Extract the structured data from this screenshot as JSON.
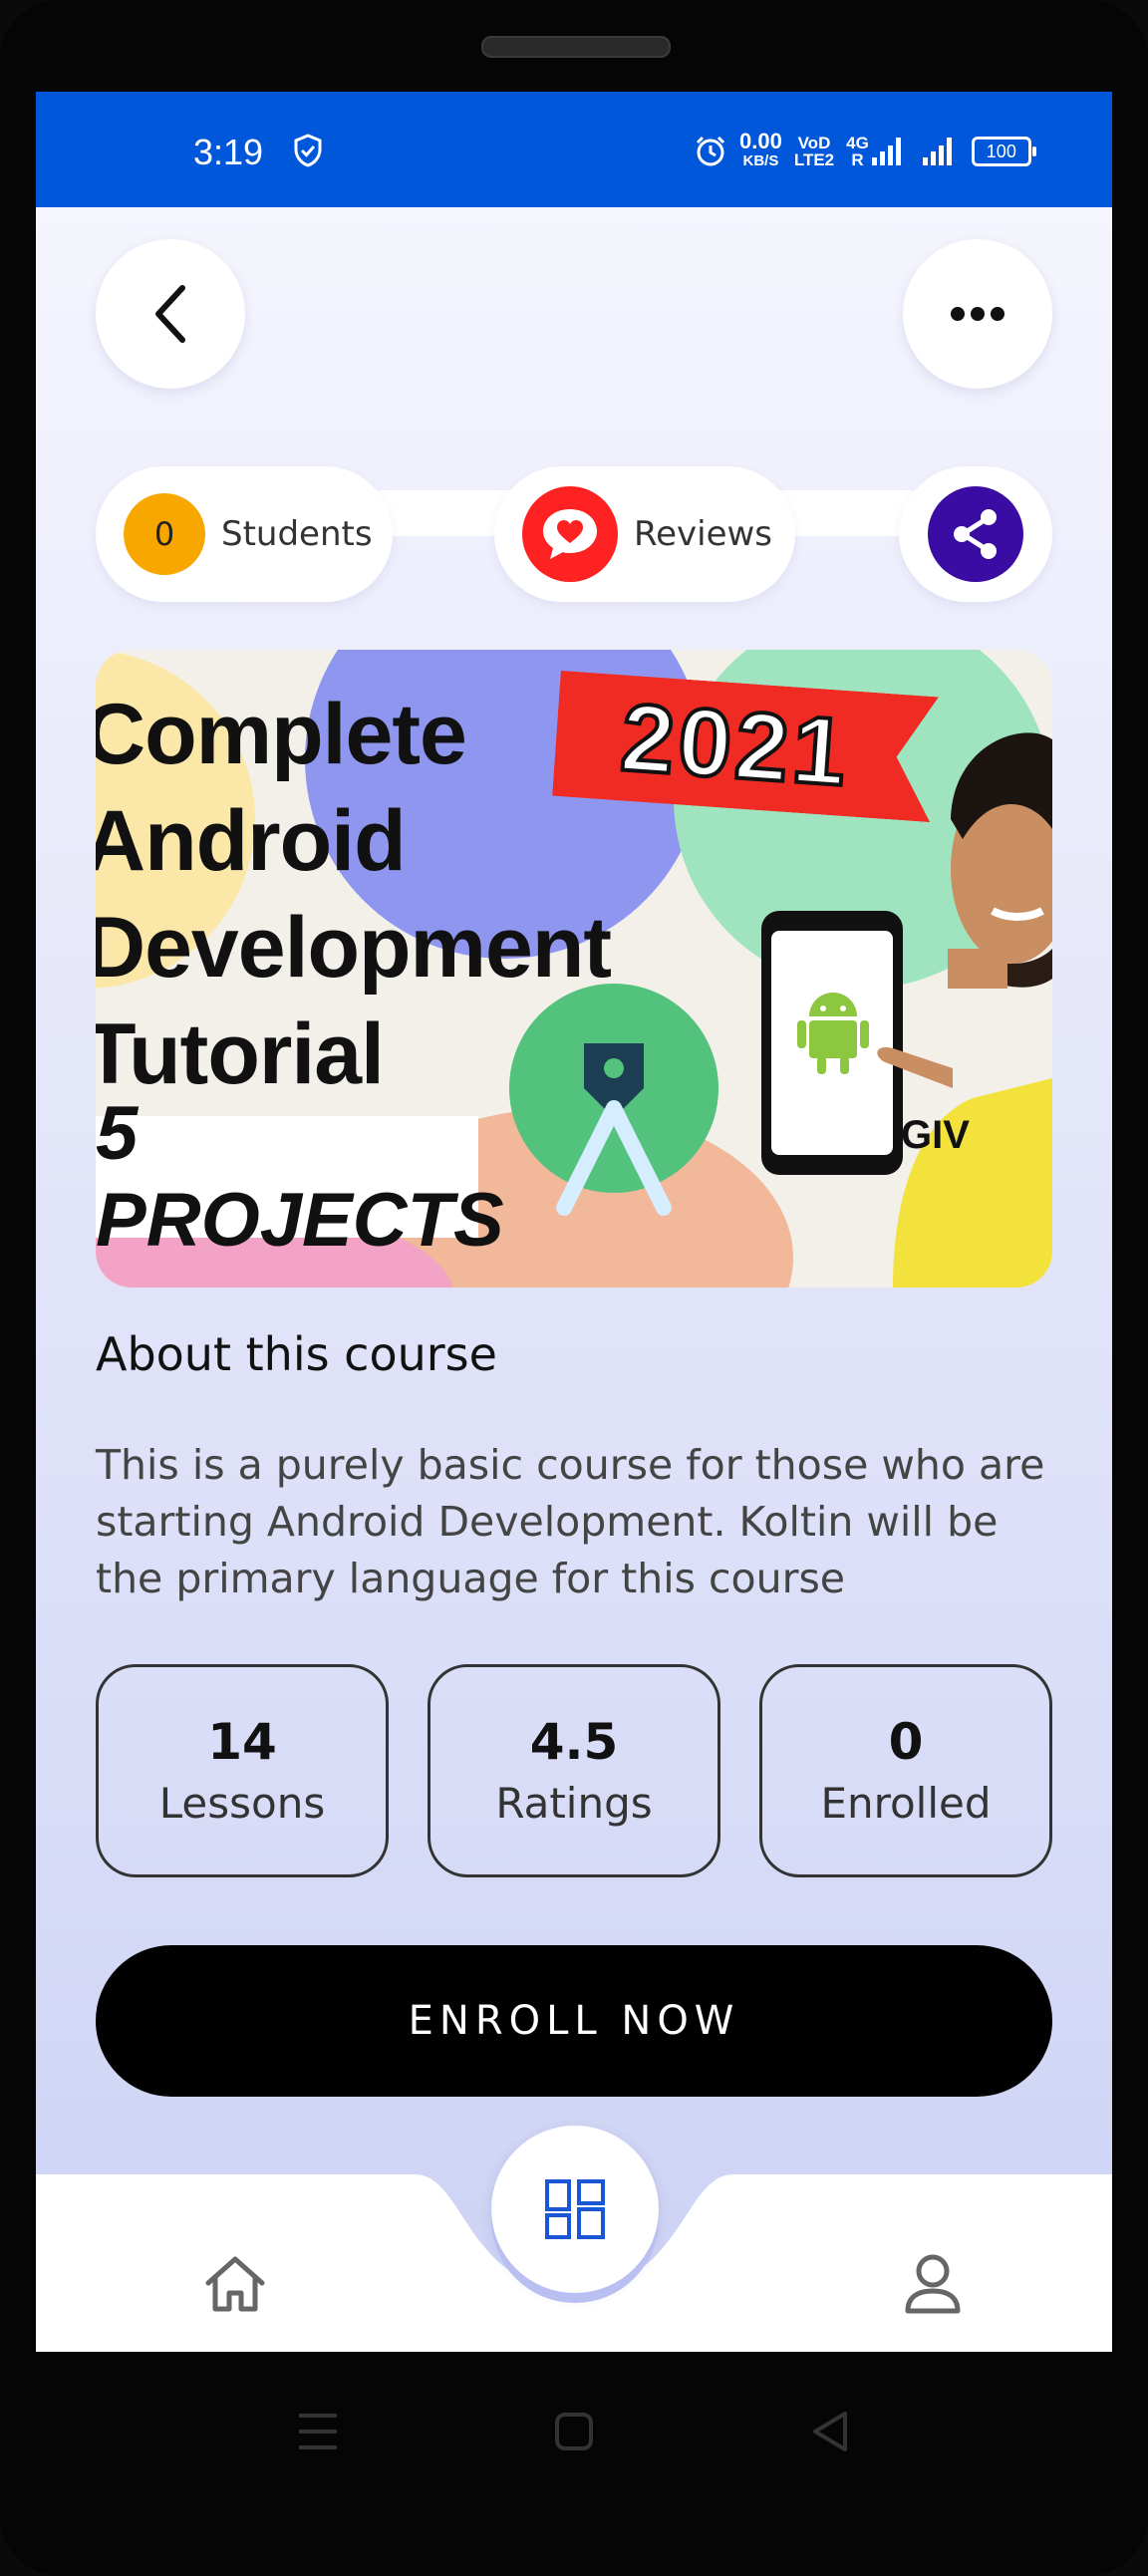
{
  "status_bar": {
    "time": "3:19",
    "net_speed_value": "0.00",
    "net_speed_unit": "KB/S",
    "volte_top": "VoD",
    "volte_bottom": "LTE2",
    "network_top": "4G",
    "network_bottom": "R",
    "battery": "100",
    "color": "#0057d9"
  },
  "header": {
    "back_icon": "chevron-left-icon",
    "more_icon": "more-horizontal-icon"
  },
  "chips": {
    "students_count": "0",
    "students_label": "Students",
    "reviews_label": "Reviews",
    "share_icon": "share-icon"
  },
  "banner": {
    "line1": "Complete",
    "line2": "Android",
    "line3": "Development",
    "line4": "Tutorial",
    "projects": "5 PROJECTS",
    "year": "2021",
    "shirt_text": "GIV"
  },
  "about": {
    "title": "About this course",
    "description": "This is a purely basic course for those who are starting Android Development. Koltin will be the primary language for this course"
  },
  "stats": [
    {
      "value": "14",
      "label": "Lessons"
    },
    {
      "value": "4.5",
      "label": "Ratings"
    },
    {
      "value": "0",
      "label": "Enrolled"
    }
  ],
  "enroll_button": "ENROLL NOW",
  "bottom_nav": {
    "home_icon": "home-icon",
    "center_icon": "dashboard-icon",
    "profile_icon": "user-icon",
    "accent": "#1a57d6"
  }
}
